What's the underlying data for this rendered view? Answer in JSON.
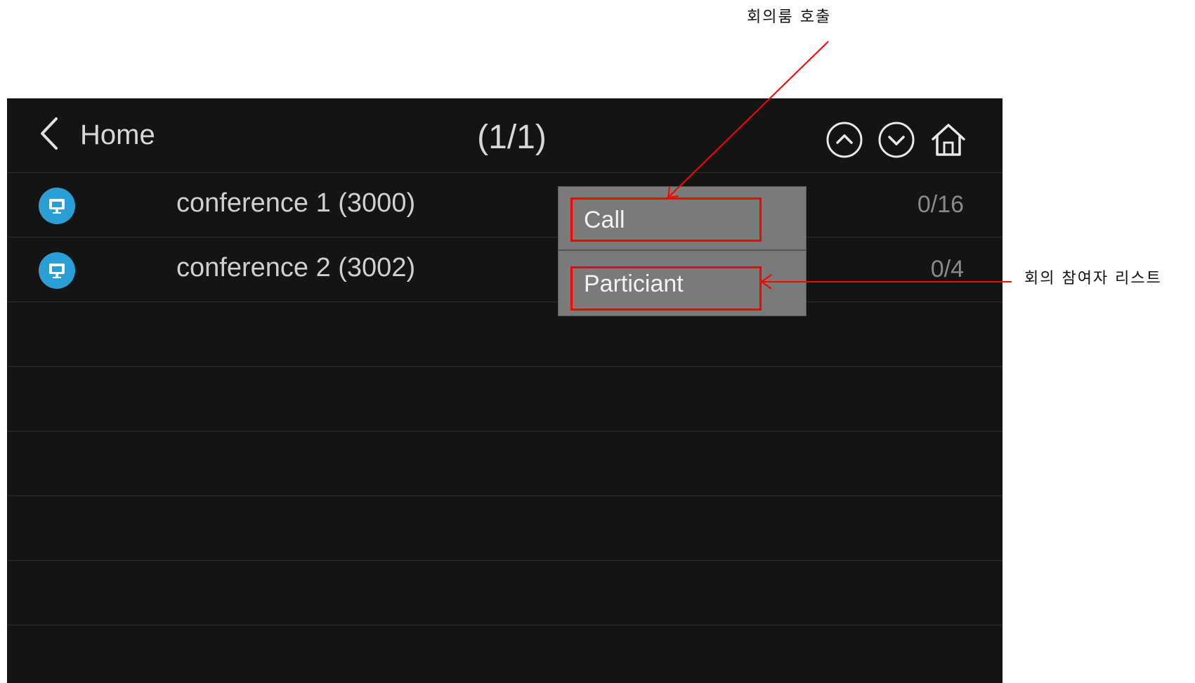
{
  "annotations": {
    "call_label": "회의룸 호출",
    "participant_label": "회의 참여자 리스트"
  },
  "header": {
    "back_label": "Home",
    "page_indicator": "(1/1)"
  },
  "conferences": [
    {
      "name": "conference 1 (3000)",
      "count": "0/16"
    },
    {
      "name": "conference 2 (3002)",
      "count": "0/4"
    }
  ],
  "popup": {
    "items": [
      "Call",
      "Particiant"
    ]
  },
  "colors": {
    "accent": "#2a9fd6",
    "highlight": "#ff0000",
    "background": "#141414"
  }
}
